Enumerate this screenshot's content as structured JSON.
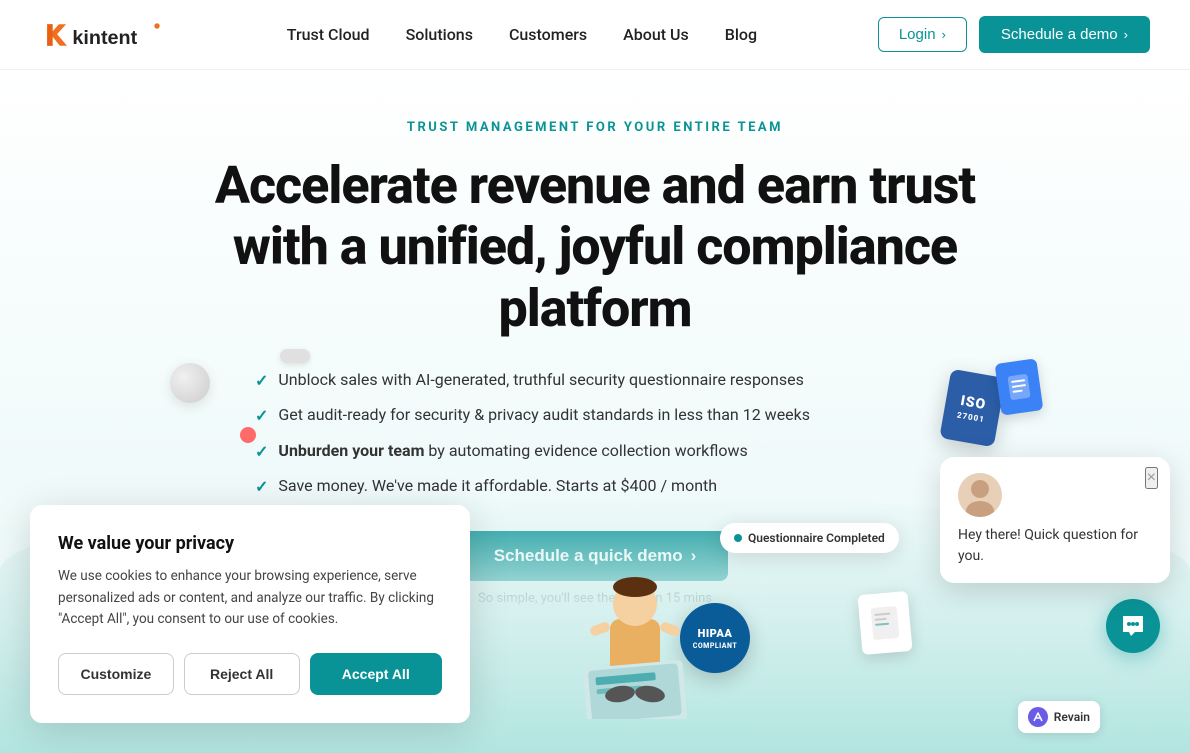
{
  "nav": {
    "logo_alt": "Kintent logo",
    "links": [
      {
        "label": "Trust Cloud",
        "id": "trust-cloud"
      },
      {
        "label": "Solutions",
        "id": "solutions"
      },
      {
        "label": "Customers",
        "id": "customers"
      },
      {
        "label": "About Us",
        "id": "about-us"
      },
      {
        "label": "Blog",
        "id": "blog"
      }
    ],
    "login_label": "Login",
    "demo_label": "Schedule a demo"
  },
  "hero": {
    "subtitle": "TRUST MANAGEMENT FOR YOUR ENTIRE TEAM",
    "title_line1": "Accelerate revenue and earn trust",
    "title_line2": "with a unified, joyful compliance platform",
    "features": [
      {
        "text": "Unblock sales with AI-generated, truthful security questionnaire responses"
      },
      {
        "text": "Get audit-ready for security & privacy audit standards in less than 12 weeks"
      },
      {
        "text_bold": "Unburden your team",
        "text_rest": " by automating evidence collection workflows"
      },
      {
        "text": "Save money. We've made it affordable. Starts at $400 / month"
      }
    ],
    "cta_label": "Schedule a quick demo",
    "cta_hint": "So simple, you'll see the value in 15 mins",
    "questionnaire_badge": "Questionnaire Completed"
  },
  "cookie": {
    "title": "We value your privacy",
    "text": "We use cookies to enhance your browsing experience, serve personalized ads or content, and analyze our traffic. By clicking \"Accept All\", you consent to our use of cookies.",
    "customize_label": "Customize",
    "reject_label": "Reject All",
    "accept_label": "Accept All"
  },
  "chat": {
    "message": "Hey there! Quick question for you.",
    "close_label": "×"
  },
  "iso_text": "ISO",
  "hipaa_text": "HIPAA",
  "hipaa_sub": "COMPLIANT"
}
